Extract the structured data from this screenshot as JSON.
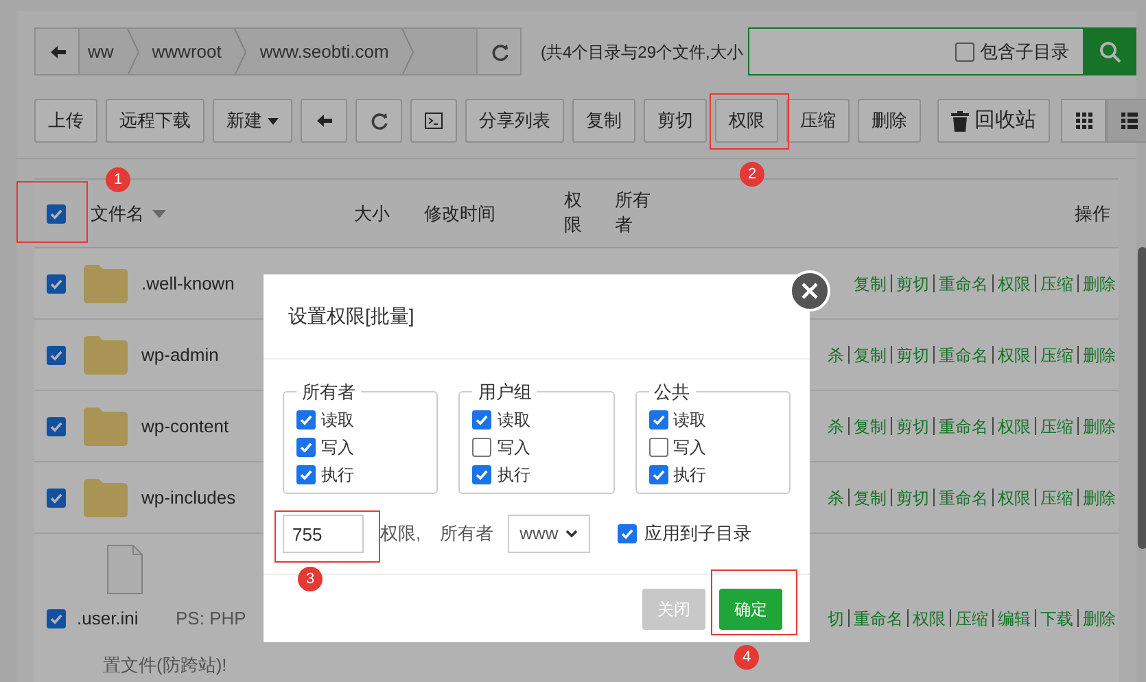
{
  "breadcrumb": {
    "segments": [
      "ww",
      "wwwroot",
      "www.seobti.com"
    ]
  },
  "summary": "(共4个目录与29个文件,大小",
  "search": {
    "include_subdirs": {
      "label": "包含子目录",
      "checked": false
    }
  },
  "toolbar": [
    {
      "kind": "text",
      "label": "上传"
    },
    {
      "kind": "text",
      "label": "远程下载"
    },
    {
      "kind": "dropdown",
      "label": "新建"
    },
    {
      "kind": "back"
    },
    {
      "kind": "refresh"
    },
    {
      "kind": "terminal"
    },
    {
      "kind": "text",
      "label": "分享列表"
    },
    {
      "kind": "text",
      "label": "复制"
    },
    {
      "kind": "text",
      "label": "剪切"
    },
    {
      "kind": "text",
      "label": "权限"
    },
    {
      "kind": "text",
      "label": "压缩"
    },
    {
      "kind": "text",
      "label": "删除"
    },
    {
      "kind": "trash",
      "label": "回收站"
    }
  ],
  "view_modes": [
    {
      "kind": "grid",
      "selected": false
    },
    {
      "kind": "list",
      "selected": true
    }
  ],
  "table": {
    "select_all": {
      "checked": true
    },
    "columns": [
      "文件名",
      "大小",
      "修改时间",
      "权限",
      "所有者",
      "操作"
    ],
    "rows": [
      {
        "kind": "folder",
        "name": ".well-known",
        "checked": true,
        "actions": [
          "复制",
          "剪切",
          "重命名",
          "权限",
          "压缩",
          "删除"
        ]
      },
      {
        "kind": "folder",
        "name": "wp-admin",
        "checked": true,
        "actions": [
          "杀",
          "复制",
          "剪切",
          "重命名",
          "权限",
          "压缩",
          "删除"
        ]
      },
      {
        "kind": "folder",
        "name": "wp-content",
        "checked": true,
        "actions": [
          "杀",
          "复制",
          "剪切",
          "重命名",
          "权限",
          "压缩",
          "删除"
        ]
      },
      {
        "kind": "folder",
        "name": "wp-includes",
        "checked": true,
        "actions": [
          "杀",
          "复制",
          "剪切",
          "重命名",
          "权限",
          "压缩",
          "删除"
        ]
      },
      {
        "kind": "file",
        "name": ".user.ini",
        "checked": true,
        "note": "PS: PHP",
        "note_continued": "置文件(防跨站)!",
        "actions": [
          "切",
          "重命名",
          "权限",
          "压缩",
          "编辑",
          "下载",
          "删除"
        ]
      }
    ]
  },
  "dialog": {
    "title": "设置权限[批量]",
    "groups": [
      {
        "legend": "所有者",
        "options": [
          {
            "label": "读取",
            "checked": true
          },
          {
            "label": "写入",
            "checked": true
          },
          {
            "label": "执行",
            "checked": true
          }
        ]
      },
      {
        "legend": "用户组",
        "options": [
          {
            "label": "读取",
            "checked": true
          },
          {
            "label": "写入",
            "checked": false
          },
          {
            "label": "执行",
            "checked": true
          }
        ]
      },
      {
        "legend": "公共",
        "options": [
          {
            "label": "读取",
            "checked": true
          },
          {
            "label": "写入",
            "checked": false
          },
          {
            "label": "执行",
            "checked": true
          }
        ]
      }
    ],
    "mode": "755",
    "mode_label": "权限,",
    "owner_label": "所有者",
    "owner": "www",
    "apply_subdirs": {
      "label": "应用到子目录",
      "checked": true
    },
    "buttons": [
      {
        "kind": "secondary",
        "label": "关闭"
      },
      {
        "kind": "primary",
        "label": "确定"
      }
    ]
  },
  "annotations": [
    {
      "label": "1"
    },
    {
      "label": "2"
    },
    {
      "label": "3"
    },
    {
      "label": "4"
    }
  ]
}
